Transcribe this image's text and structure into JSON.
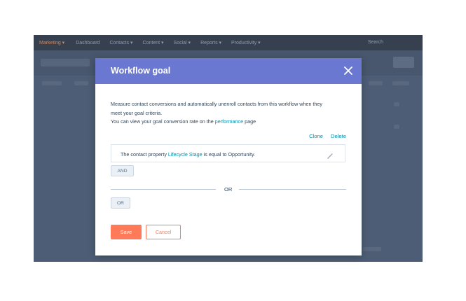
{
  "app": {
    "nav_brand": "Marketing ▾",
    "nav_items": [
      "Dashboard",
      "Contacts ▾",
      "Content ▾",
      "Social ▾",
      "Reports ▾",
      "Productivity ▾"
    ],
    "search_label": "Search"
  },
  "modal": {
    "title": "Workflow goal",
    "description_line1": "Measure contact conversions and automatically unenroll contacts from this workflow when they",
    "description_line2": "meet your goal criteria.",
    "description_line3_prefix": "You can view your goal conversion rate on the",
    "description_link": "performance",
    "description_line3_suffix": "page",
    "clone_label": "Clone",
    "delete_label": "Delete",
    "rule": {
      "prefix": "The contact property",
      "property": "Lifecycle Stage",
      "middle": "is equal to",
      "value": "Opportunity."
    },
    "and_label": "AND",
    "or_divider": "OR",
    "or_label": "OR",
    "save_label": "Save",
    "cancel_label": "Cancel"
  },
  "colors": {
    "header": "#6a78d1",
    "accent": "#ff7a59",
    "link": "#0091ae",
    "overlay": "#4d5d75"
  }
}
